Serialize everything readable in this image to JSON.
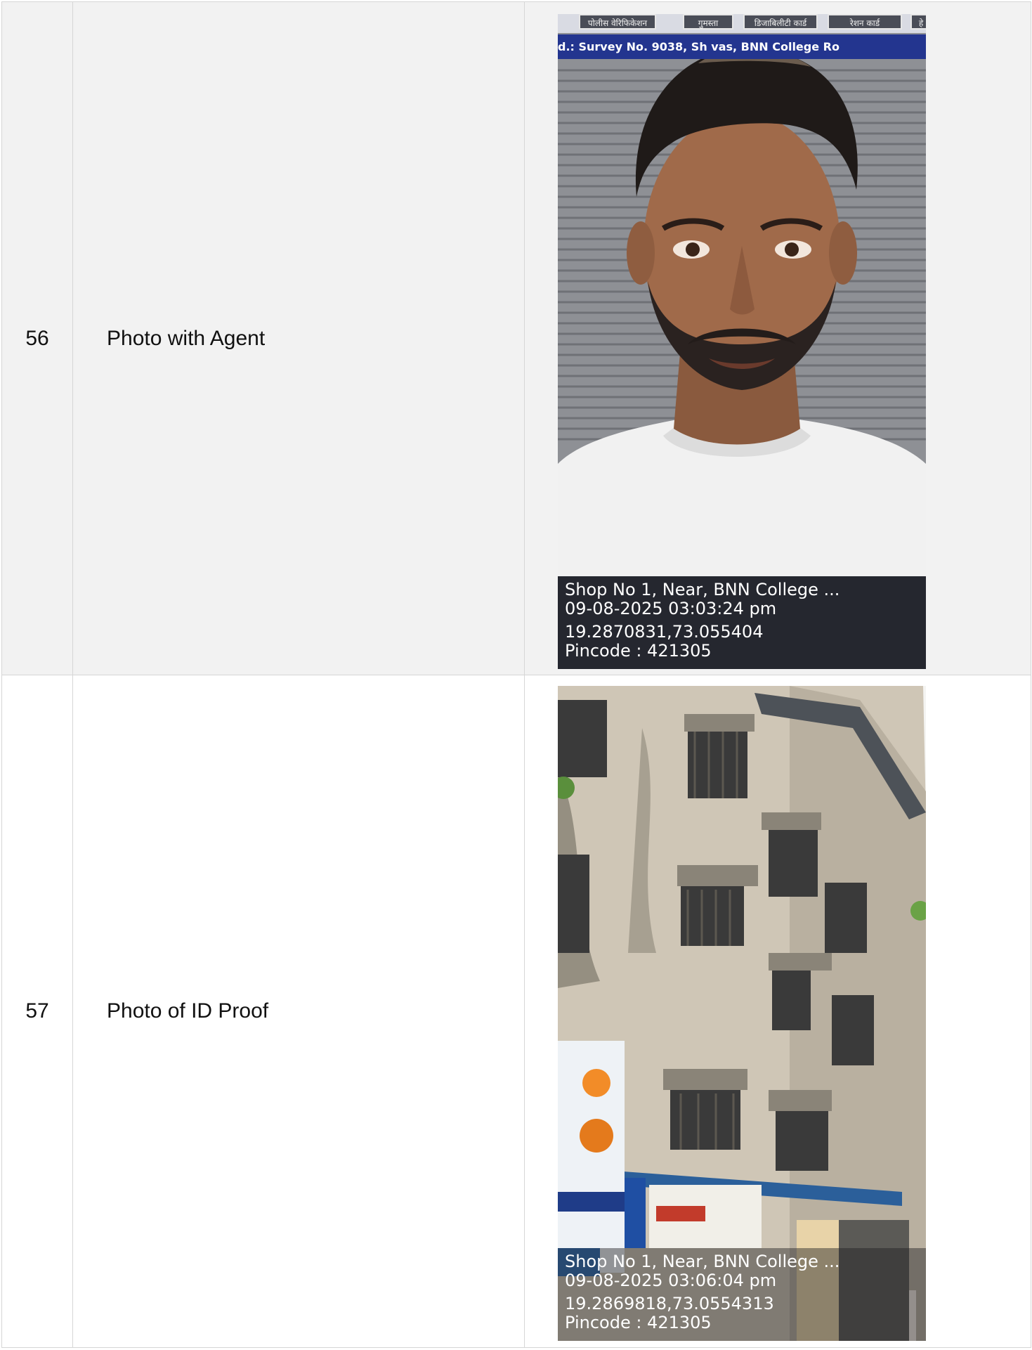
{
  "rows": [
    {
      "number": "56",
      "label": "Photo with Agent",
      "photo": {
        "subject": "selfie-portrait",
        "signboard_tabs": [
          "पोलीस वेरिफिकेशन",
          "गुमस्ता",
          "डिजाबिलीटी कार्ड",
          "रेशन कार्ड",
          "हे"
        ],
        "signboard_address": "d.: Survey No. 9038, Sh                   vas, BNN College Ro",
        "stamp": {
          "address": "Shop No 1, Near, BNN College ...",
          "datetime": "09-08-2025 03:03:24 pm",
          "coordinates": "19.2870831,73.055404",
          "pincode": "Pincode : 421305"
        }
      }
    },
    {
      "number": "57",
      "label": "Photo of ID Proof",
      "photo": {
        "subject": "building-facade",
        "stamp": {
          "address": "Shop No 1, Near, BNN College ...",
          "datetime": "09-08-2025 03:06:04 pm",
          "coordinates": "19.2869818,73.0554313",
          "pincode": "Pincode : 421305"
        }
      }
    }
  ]
}
